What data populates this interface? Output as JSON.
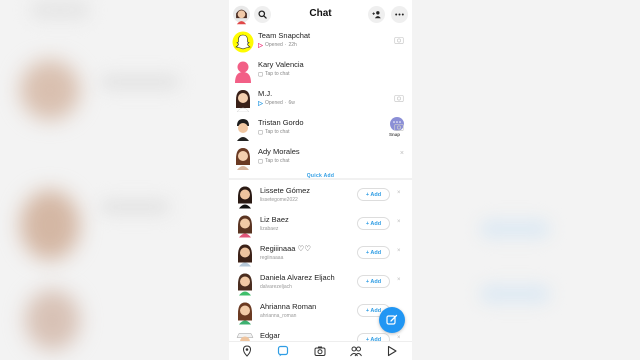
{
  "header": {
    "title": "Chat"
  },
  "chats": [
    {
      "name": "Team Snapchat",
      "status": "Opened",
      "time": "22h",
      "status_color": "#f0357a",
      "kind": "sent"
    },
    {
      "name": "Kary Valencia",
      "status": "Tap to chat",
      "time": "",
      "status_color": "#aaaaaa",
      "kind": "chat"
    },
    {
      "name": "M.J.",
      "status": "Opened",
      "time": "6w",
      "status_color": "#2f9de4",
      "kind": "sent"
    },
    {
      "name": "Tristan Gordo",
      "status": "Tap to chat",
      "time": "",
      "status_color": "#aaaaaa",
      "kind": "chat"
    },
    {
      "name": "Ady Morales",
      "status": "Tap to chat",
      "time": "",
      "status_color": "#aaaaaa",
      "kind": "chat"
    }
  ],
  "snap_button": {
    "label": "Snap"
  },
  "quick_add": {
    "heading": "Quick Add",
    "add_label": "+ Add",
    "dismiss_glyph": "×",
    "people": [
      {
        "name": "Lissete Gómez",
        "username": "lissetegome2022"
      },
      {
        "name": "Liz Baez",
        "username": "lizabaez"
      },
      {
        "name": "Regiiinaaa ♡♡",
        "username": "regiinaaaa"
      },
      {
        "name": "Daniela Alvarez Eljach",
        "username": "dalvarezeljach"
      },
      {
        "name": "Ahrianna Roman",
        "username": "ahrianna_roman"
      },
      {
        "name": "Edgar",
        "username": ""
      }
    ]
  },
  "colors": {
    "accent": "#2f9de4",
    "fab": "#2196f3",
    "snapchat_yellow": "#fffc00"
  },
  "nav": {
    "icons": [
      "map-icon",
      "chat-icon",
      "camera-icon",
      "friends-icon",
      "discover-icon"
    ]
  }
}
